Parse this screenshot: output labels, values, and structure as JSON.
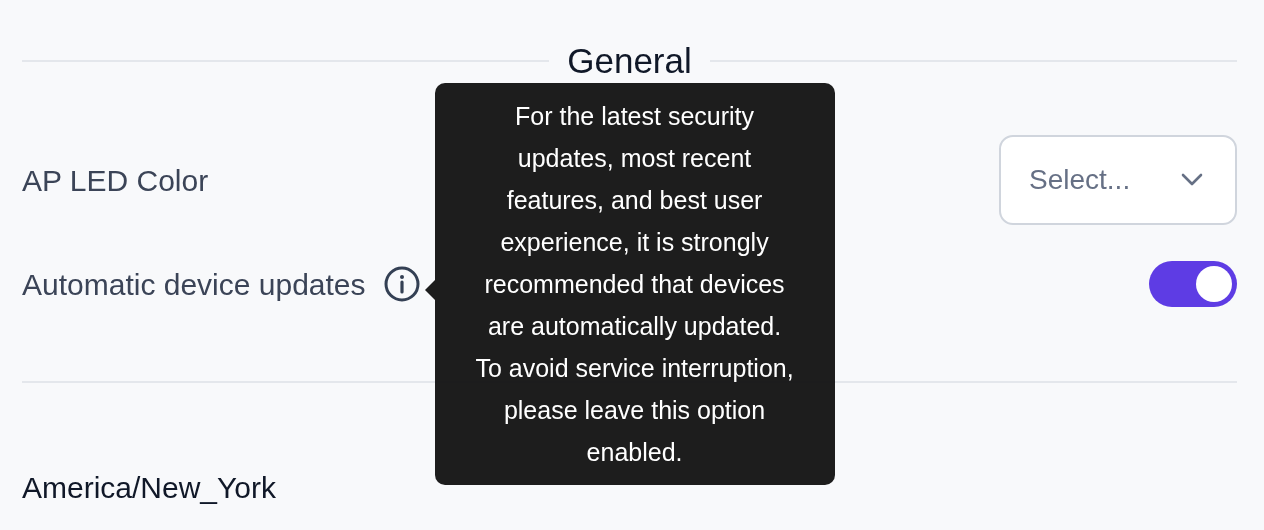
{
  "sections": [
    {
      "heading": "General",
      "rows": [
        {
          "kind": "select",
          "label": "AP LED Color",
          "placeholder": "Select..."
        },
        {
          "kind": "toggle",
          "label": "Automatic device updates",
          "on": true,
          "tooltip": "For the latest security updates, most recent features, and best user experience, it is strongly recommended that devices are automatically updated. To avoid service interruption, please leave this option enabled."
        }
      ]
    },
    {
      "rows": [
        {
          "kind": "text",
          "value": "America/New_York"
        }
      ]
    }
  ]
}
